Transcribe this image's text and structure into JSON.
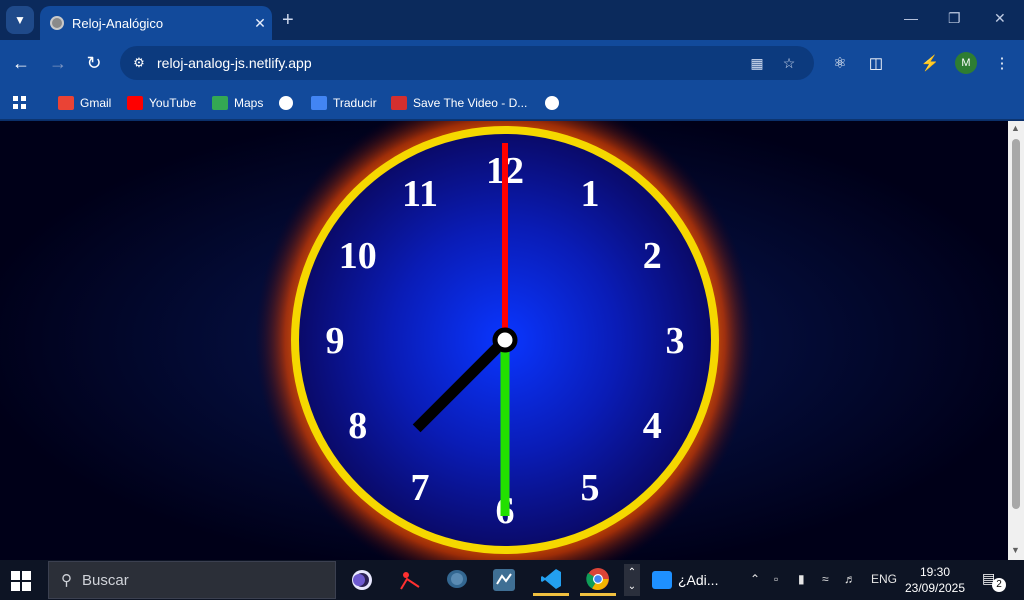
{
  "tab": {
    "title": "Reloj-Analógico"
  },
  "omnibox": {
    "url": "reloj-analog-js.netlify.app"
  },
  "bookmarks": [
    {
      "label": "Gmail",
      "icon": "gmail-icon",
      "color": "#ea4335"
    },
    {
      "label": "YouTube",
      "icon": "youtube-icon",
      "color": "#ff0000"
    },
    {
      "label": "Maps",
      "icon": "maps-icon",
      "color": "#34a853"
    },
    {
      "label": "",
      "icon": "globe-icon",
      "color": "#ffffff"
    },
    {
      "label": "Traducir",
      "icon": "translate-icon",
      "color": "#4285f4"
    },
    {
      "label": "Save The Video - D...",
      "icon": "save-video-icon",
      "color": "#d32f2f"
    },
    {
      "label": "",
      "icon": "globe-icon",
      "color": "#ffffff"
    }
  ],
  "clock": {
    "numerals": [
      "12",
      "1",
      "2",
      "3",
      "4",
      "5",
      "6",
      "7",
      "8",
      "9",
      "10",
      "11"
    ],
    "time": {
      "hour": 7,
      "minute": 30,
      "second": 0
    },
    "colors": {
      "rim": "#f5d800",
      "glow": "#ff6a00",
      "face_center": "#0030ff",
      "face_edge": "#0a0a6a",
      "hour_hand": "#000000",
      "minute_hand": "#22e000",
      "second_hand": "#ff0000",
      "numerals": "#ffffff"
    }
  },
  "taskbar": {
    "search_placeholder": "Buscar",
    "notification_text": "¿Adi...",
    "language": "ENG",
    "time": "19:30",
    "date": "23/09/2025",
    "notification_count": "2"
  },
  "account": {
    "initial": "M"
  }
}
